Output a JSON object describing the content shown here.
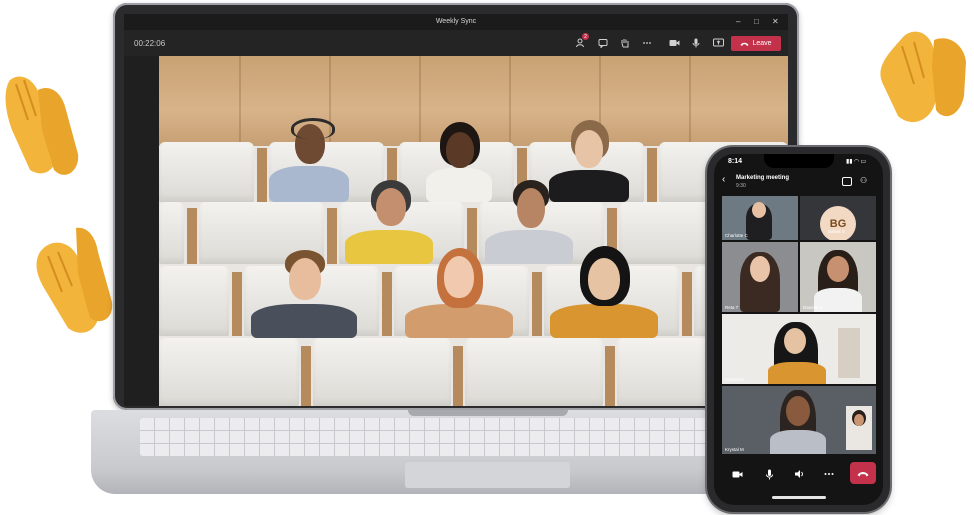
{
  "window": {
    "title": "Weekly Sync",
    "minimize": "–",
    "maximize": "□",
    "close": "✕"
  },
  "toolbar": {
    "timer": "00:22:06",
    "participants_badge": "2",
    "leave_label": "Leave",
    "icons": [
      "participants-icon",
      "chat-icon",
      "raise-hand-icon",
      "more-icon",
      "camera-icon",
      "mic-icon",
      "share-screen-icon",
      "phone-hangup-icon"
    ],
    "accent": "#c4314b"
  },
  "phone": {
    "time": "8:14",
    "meeting_title": "Marketing meeting",
    "meeting_time": "9:30",
    "avatar_initials": "BG",
    "tiles": [
      {
        "name": "Charlotte C"
      },
      {
        "name": "Babak S"
      },
      {
        "name": "Reta T"
      },
      {
        "name": "Daniela G"
      },
      {
        "name": "Krystal M"
      },
      {
        "name": "Krystal M"
      }
    ],
    "controls": [
      "camera-icon",
      "mic-icon",
      "speaker-icon",
      "more-icon",
      "end-call-icon"
    ]
  }
}
